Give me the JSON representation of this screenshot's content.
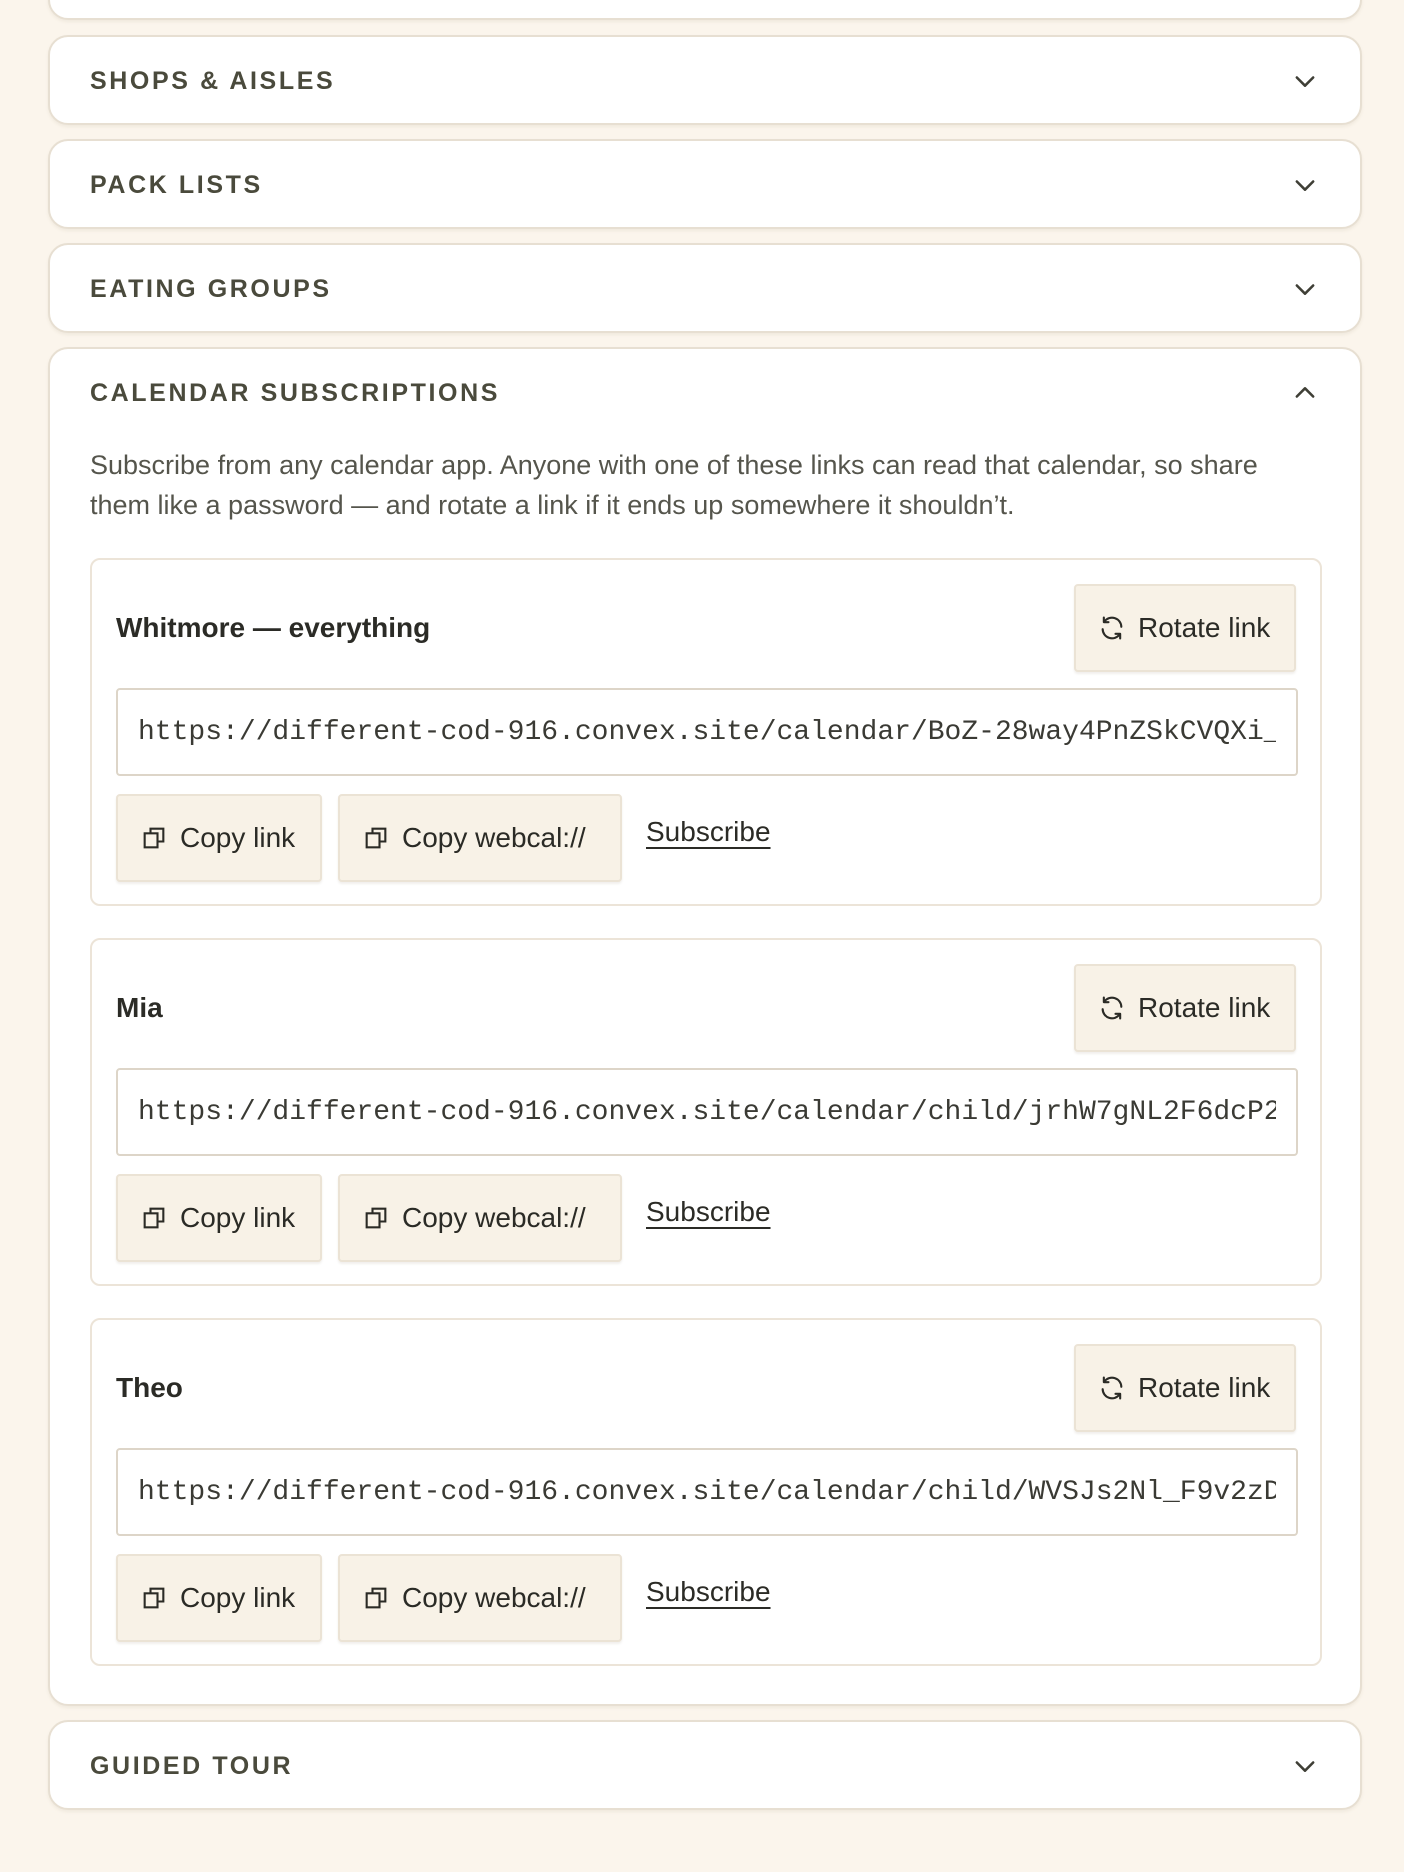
{
  "sections": {
    "shops_aisles": {
      "title": "SHOPS & AISLES",
      "chevron": "chevron-down-icon"
    },
    "pack_lists": {
      "title": "PACK LISTS",
      "chevron": "chevron-down-icon"
    },
    "eating_groups": {
      "title": "EATING GROUPS",
      "chevron": "chevron-down-icon"
    },
    "calendar_subscriptions": {
      "title": "CALENDAR SUBSCRIPTIONS",
      "chevron": "chevron-up-icon",
      "description": "Subscribe from any calendar app. Anyone with one of these links can read that calendar, so share them like a password — and rotate a link if it ends up somewhere it shouldn’t.",
      "calendars": [
        {
          "name": "Whitmore — everything",
          "url": "https://different-cod-916.convex.site/calendar/BoZ-28way4PnZSkCVQXi_",
          "rotate_label": "Rotate link",
          "copy_label": "Copy link",
          "webcal_label": "Copy webcal://",
          "subscribe_label": "Subscribe"
        },
        {
          "name": "Mia",
          "url": "https://different-cod-916.convex.site/calendar/child/jrhW7gNL2F6dcP2",
          "rotate_label": "Rotate link",
          "copy_label": "Copy link",
          "webcal_label": "Copy webcal://",
          "subscribe_label": "Subscribe"
        },
        {
          "name": "Theo",
          "url": "https://different-cod-916.convex.site/calendar/child/WVSJs2Nl_F9v2zD",
          "rotate_label": "Rotate link",
          "copy_label": "Copy link",
          "webcal_label": "Copy webcal://",
          "subscribe_label": "Subscribe"
        }
      ]
    },
    "guided_tour": {
      "title": "GUIDED TOUR",
      "chevron": "chevron-down-icon"
    }
  },
  "colors": {
    "page_background": "#fbf5ec",
    "card_background": "#ffffff",
    "button_background": "#f8f2e7",
    "section_title": "#4a4a3c"
  }
}
